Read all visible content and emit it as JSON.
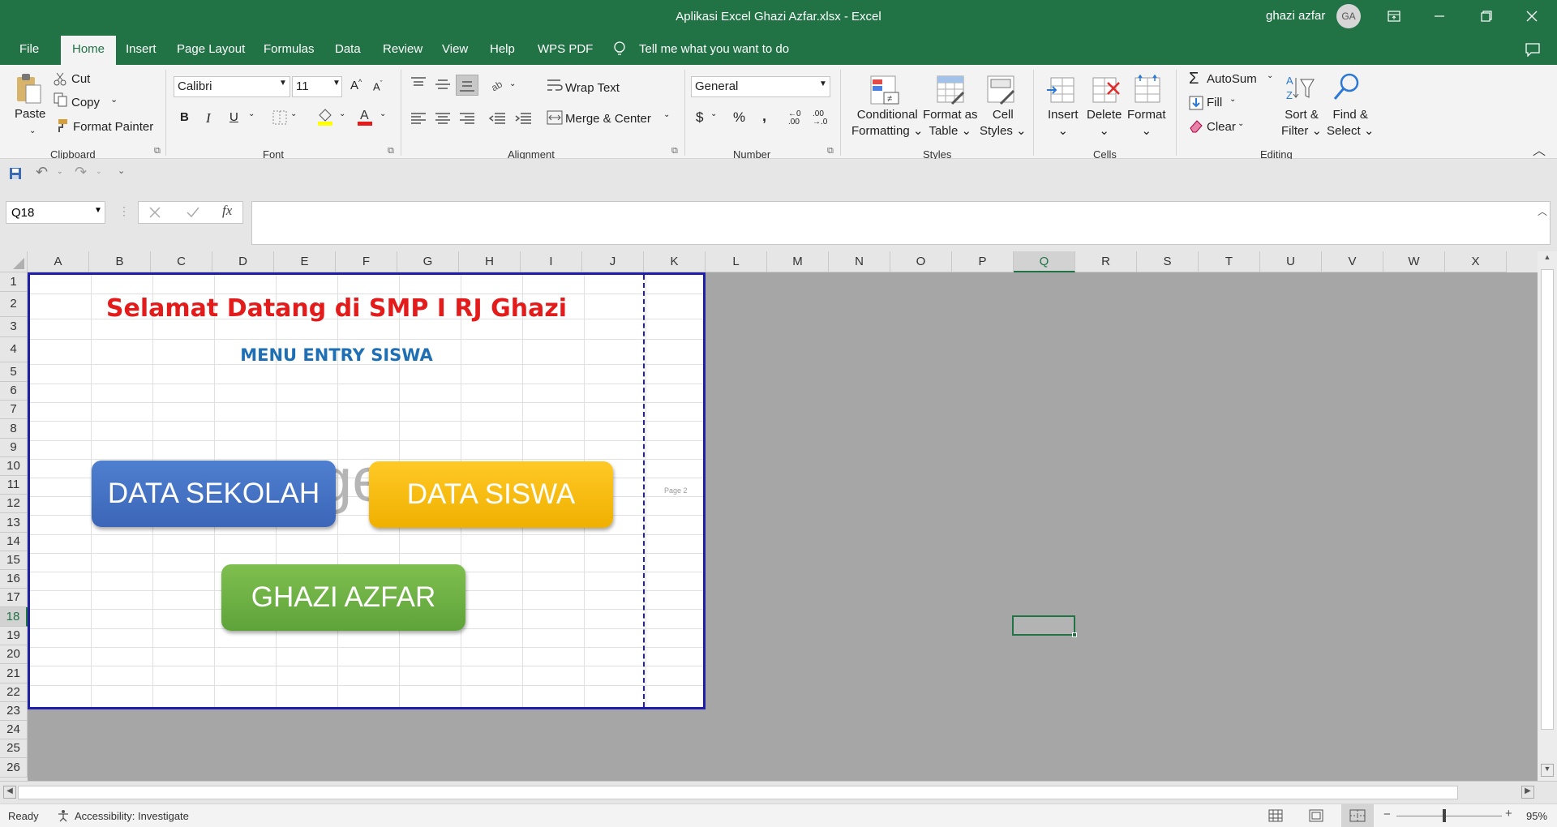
{
  "window": {
    "title": "Aplikasi Excel Ghazi Azfar.xlsx  -  Excel",
    "user": "ghazi azfar",
    "avatar": "GA"
  },
  "tabs": [
    "File",
    "Home",
    "Insert",
    "Page Layout",
    "Formulas",
    "Data",
    "Review",
    "View",
    "Help",
    "WPS PDF"
  ],
  "active_tab": "Home",
  "tell_me": "Tell me what you want to do",
  "ribbon": {
    "clipboard": {
      "paste": "Paste",
      "cut": "Cut",
      "copy": "Copy",
      "format_painter": "Format Painter",
      "label": "Clipboard"
    },
    "font": {
      "name": "Calibri",
      "size": "11",
      "bold": "B",
      "italic": "I",
      "underline": "U",
      "label": "Font"
    },
    "alignment": {
      "wrap": "Wrap Text",
      "merge": "Merge & Center",
      "label": "Alignment"
    },
    "number": {
      "format": "General",
      "currency": "$",
      "percent": "%",
      "comma": ",",
      "label": "Number"
    },
    "styles": {
      "conditional": [
        "Conditional",
        "Formatting"
      ],
      "format_table": [
        "Format as",
        "Table"
      ],
      "cell_styles": [
        "Cell",
        "Styles"
      ],
      "label": "Styles"
    },
    "cells": {
      "insert": "Insert",
      "delete": "Delete",
      "format": "Format",
      "label": "Cells"
    },
    "editing": {
      "autosum": "AutoSum",
      "fill": "Fill",
      "clear": "Clear",
      "sort": [
        "Sort &",
        "Filter"
      ],
      "find": [
        "Find &",
        "Select"
      ],
      "label": "Editing"
    }
  },
  "formula_bar": {
    "name_box": "Q18",
    "fx": "fx",
    "formula": ""
  },
  "columns": [
    "A",
    "B",
    "C",
    "D",
    "E",
    "F",
    "G",
    "H",
    "I",
    "J",
    "K",
    "L",
    "M",
    "N",
    "O",
    "P",
    "Q",
    "R",
    "S",
    "T",
    "U",
    "V",
    "W",
    "X"
  ],
  "selected_column": "Q",
  "rows": [
    "1",
    "2",
    "3",
    "4",
    "5",
    "6",
    "7",
    "8",
    "9",
    "10",
    "11",
    "12",
    "13",
    "14",
    "15",
    "16",
    "17",
    "18",
    "19",
    "20",
    "21",
    "22",
    "23",
    "24",
    "25",
    "26"
  ],
  "selected_row": "18",
  "sheet": {
    "title": "Selamat Datang di SMP I RJ Ghazi",
    "subtitle": "MENU ENTRY SISWA",
    "watermark": "ge",
    "page2": "Page 2",
    "buttons": {
      "sekolah": "DATA SEKOLAH",
      "siswa": "DATA SISWA",
      "ghazi": "GHAZI AZFAR"
    },
    "colors": {
      "title": "#e31b1b",
      "subtitle": "#1f6fb5",
      "sekolah": "#4472c4",
      "siswa": "#ffc000",
      "ghazi": "#70ad47"
    }
  },
  "status": {
    "ready": "Ready",
    "accessibility": "Accessibility: Investigate",
    "zoom": "95%"
  }
}
